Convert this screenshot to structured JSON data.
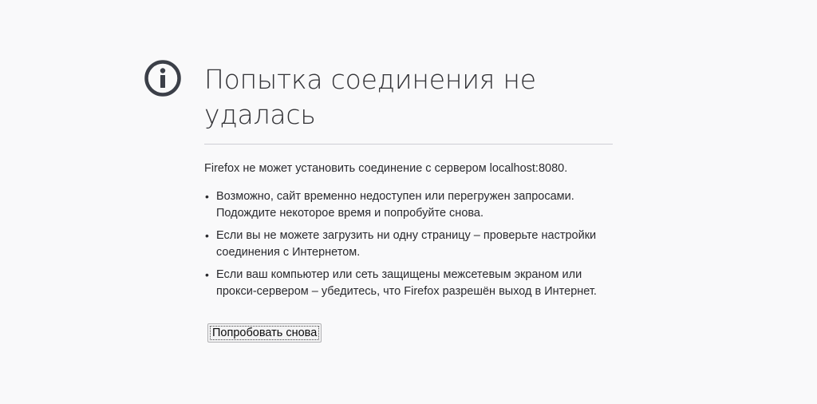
{
  "page": {
    "title": "Попытка соединения не удалась",
    "short_description": "Firefox не может установить соединение с сервером localhost:8080.",
    "icon": "info-icon",
    "icon_color": "#3b3f48"
  },
  "hints": [
    "Возможно, сайт временно недоступен или перегружен запросами. Подождите некоторое время и попробуйте снова.",
    "Если вы не можете загрузить ни одну страницу – проверьте настройки соединения с Интернетом.",
    "Если ваш компьютер или сеть защищены межсетевым экраном или прокси-сервером – убедитесь, что Firefox разрешён выход в Интернет."
  ],
  "bullet": "•",
  "actions": {
    "try_again_label": "Попробовать снова"
  }
}
